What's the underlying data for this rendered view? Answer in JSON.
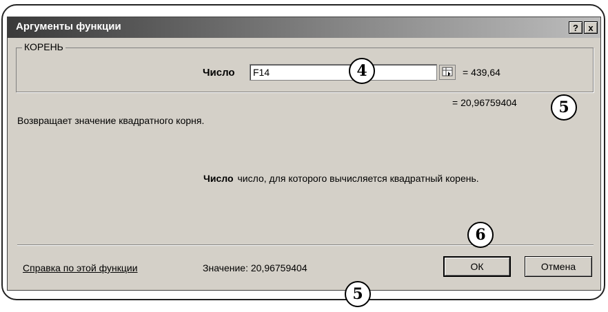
{
  "dialog": {
    "title": "Аргументы функции",
    "help_button": "?",
    "close_button": "x",
    "group_label": "КОРЕНЬ",
    "argument": {
      "label": "Число",
      "input_value": "F14",
      "evaluated_value": "= 439,64"
    },
    "result_line": "= 20,96759404",
    "description": "Возвращает значение квадратного корня.",
    "argument_description": {
      "name": "Число",
      "text": "число, для которого вычисляется квадратный корень."
    },
    "help_link": "Справка по этой функции",
    "value_label": "Значение: 20,96759404",
    "ok_button": "ОК",
    "cancel_button": "Отмена"
  },
  "callouts": {
    "input_marker": "4",
    "result_marker": "5",
    "value_marker": "5",
    "ok_marker": "6"
  }
}
